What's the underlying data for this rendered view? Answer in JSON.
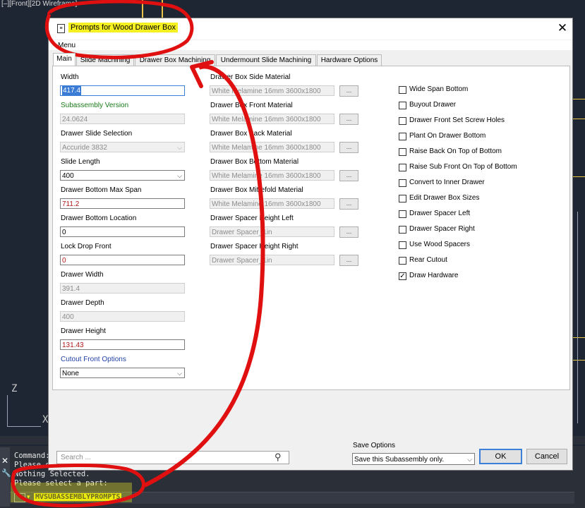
{
  "viewport": {
    "label": "[–][Front][2D Wireframe]"
  },
  "axes": {
    "z": "Z",
    "x": "X"
  },
  "dialog": {
    "title": "Prompts for Wood Drawer Box",
    "menu": "Menu",
    "tabs": [
      "Main",
      "Slide Machining",
      "Drawer Box Machining",
      "Undermount Slide Machining",
      "Hardware Options"
    ],
    "left_fields": [
      {
        "label": "Width",
        "value": "417.4"
      },
      {
        "label": "Subassembly Version",
        "value": "24.0624"
      },
      {
        "label": "Drawer Slide Selection",
        "value": "Accuride 3832"
      },
      {
        "label": "Slide Length",
        "value": "400"
      },
      {
        "label": "Drawer Bottom Max Span",
        "value": "711.2"
      },
      {
        "label": "Drawer Bottom Location",
        "value": "0"
      },
      {
        "label": "Lock Drop Front",
        "value": "0"
      },
      {
        "label": "Drawer Width",
        "value": "391.4"
      },
      {
        "label": "Drawer Depth",
        "value": "400"
      },
      {
        "label": "Drawer Height",
        "value": "131.43"
      },
      {
        "label": "Cutout Front Options",
        "value": "None"
      }
    ],
    "materials": [
      {
        "label": "Drawer Box Side Material",
        "value": "White Melamine 16mm 3600x1800"
      },
      {
        "label": "Drawer Box Front Material",
        "value": "White Melamine 16mm 3600x1800"
      },
      {
        "label": "Drawer Box Back Material",
        "value": "White Melamine 16mm 3600x1800"
      },
      {
        "label": "Drawer Box Bottom Material",
        "value": "White Melamine 16mm 3600x1800"
      },
      {
        "label": "Drawer Box Mitrefold Material",
        "value": "White Melamine 16mm 3600x1800"
      },
      {
        "label": "Drawer Spacer Height Left",
        "value": "Drawer Spacer_1in"
      },
      {
        "label": "Drawer Spacer Height Right",
        "value": "Drawer Spacer_1in"
      }
    ],
    "browse_label": "...",
    "checkboxes": [
      {
        "label": "Wide Span Bottom",
        "checked": false
      },
      {
        "label": "Buyout Drawer",
        "checked": false
      },
      {
        "label": "Drawer Front Set Screw Holes",
        "checked": false
      },
      {
        "label": "Plant On Drawer Bottom",
        "checked": false
      },
      {
        "label": "Raise Back On Top of Bottom",
        "checked": false
      },
      {
        "label": "Raise Sub Front On Top of Bottom",
        "checked": false
      },
      {
        "label": "Convert to Inner Drawer",
        "checked": false
      },
      {
        "label": "Edit Drawer Box Sizes",
        "checked": false
      },
      {
        "label": "Drawer Spacer Left",
        "checked": false
      },
      {
        "label": "Drawer Spacer Right",
        "checked": false
      },
      {
        "label": "Use Wood Spacers",
        "checked": false
      },
      {
        "label": "Rear Cutout",
        "checked": false
      },
      {
        "label": "Draw Hardware",
        "checked": true
      }
    ],
    "search": {
      "placeholder": "Search ..."
    },
    "save_options": {
      "label": "Save Options",
      "value": "Save this Subassembly only."
    },
    "ok": "OK",
    "cancel": "Cancel"
  },
  "command": {
    "lines": [
      "Command:",
      "Please se",
      "Nothing Selected.",
      "Please select a part:"
    ],
    "input": "MVSUBASSEMBLYPROMPTS"
  },
  "colors": {
    "annotation": "#e01010",
    "highlight": "#f4f021",
    "accent": "#3c7fd6"
  }
}
